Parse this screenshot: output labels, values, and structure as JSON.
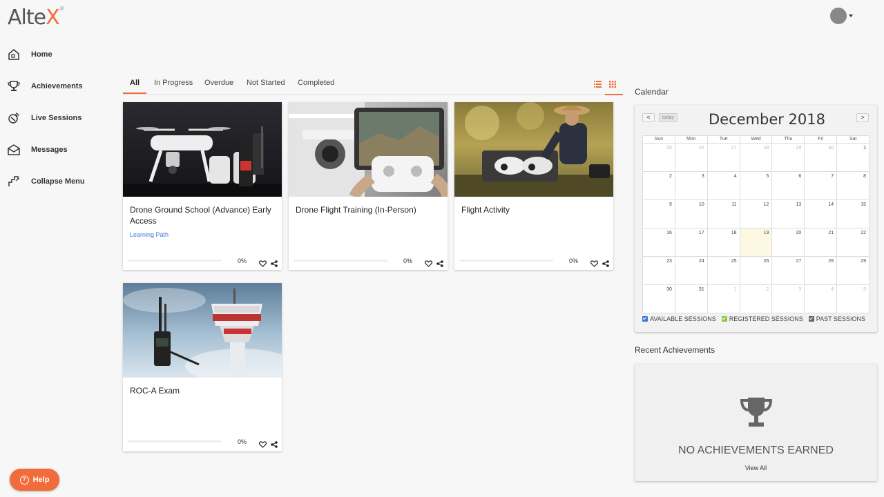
{
  "brand": {
    "name_a": "Alte",
    "name_b": "X",
    "mark": "®",
    "accent": "#f26b3a"
  },
  "sidebar": {
    "items": [
      {
        "label": "Home",
        "icon": "home-icon"
      },
      {
        "label": "Achievements",
        "icon": "trophy-icon"
      },
      {
        "label": "Live Sessions",
        "icon": "live-sessions-icon"
      },
      {
        "label": "Messages",
        "icon": "envelope-icon"
      },
      {
        "label": "Collapse Menu",
        "icon": "collapse-icon"
      }
    ]
  },
  "tabs": [
    {
      "label": "All",
      "active": true
    },
    {
      "label": "In Progress",
      "active": false
    },
    {
      "label": "Overdue",
      "active": false
    },
    {
      "label": "Not Started",
      "active": false
    },
    {
      "label": "Completed",
      "active": false
    }
  ],
  "cards": [
    {
      "title": "Drone Ground School (Advance) Early Access",
      "subtitle": "Learning Path",
      "progress_percent": 0,
      "progress_label": "0%",
      "image": "drone-with-controllers"
    },
    {
      "title": "Drone Flight Training (In-Person)",
      "subtitle": "",
      "progress_percent": 0,
      "progress_label": "0%",
      "image": "drone-remote-tablet"
    },
    {
      "title": "Flight Activity",
      "subtitle": "",
      "progress_percent": 0,
      "progress_label": "0%",
      "image": "man-with-drones"
    },
    {
      "title": "ROC-A Exam",
      "subtitle": "",
      "progress_percent": 0,
      "progress_label": "0%",
      "image": "radio-control-tower"
    }
  ],
  "calendar": {
    "heading": "Calendar",
    "month_title": "December 2018",
    "prev_label": "<",
    "next_label": ">",
    "today_label": "today",
    "weekdays": [
      "Sun",
      "Mon",
      "Tue",
      "Wed",
      "Thu",
      "Fri",
      "Sat"
    ],
    "weeks": [
      [
        "25",
        "26",
        "27",
        "28",
        "29",
        "30",
        "1"
      ],
      [
        "2",
        "3",
        "4",
        "5",
        "6",
        "7",
        "8"
      ],
      [
        "9",
        "10",
        "11",
        "12",
        "13",
        "14",
        "15"
      ],
      [
        "16",
        "17",
        "18",
        "19",
        "20",
        "21",
        "22"
      ],
      [
        "23",
        "24",
        "25",
        "26",
        "27",
        "28",
        "29"
      ],
      [
        "30",
        "31",
        "1",
        "2",
        "3",
        "4",
        "5"
      ]
    ],
    "today": "19",
    "legend": [
      {
        "label": "AVAILABLE SESSIONS",
        "color": "#3a7bd5"
      },
      {
        "label": "REGISTERED SESSIONS",
        "color": "#8dc63f"
      },
      {
        "label": "PAST SESSIONS",
        "color": "#666666"
      }
    ]
  },
  "achievements": {
    "heading": "Recent Achievements",
    "empty_text": "NO ACHIEVEMENTS EARNED",
    "view_all_label": "View All"
  },
  "help": {
    "label": "Help"
  }
}
